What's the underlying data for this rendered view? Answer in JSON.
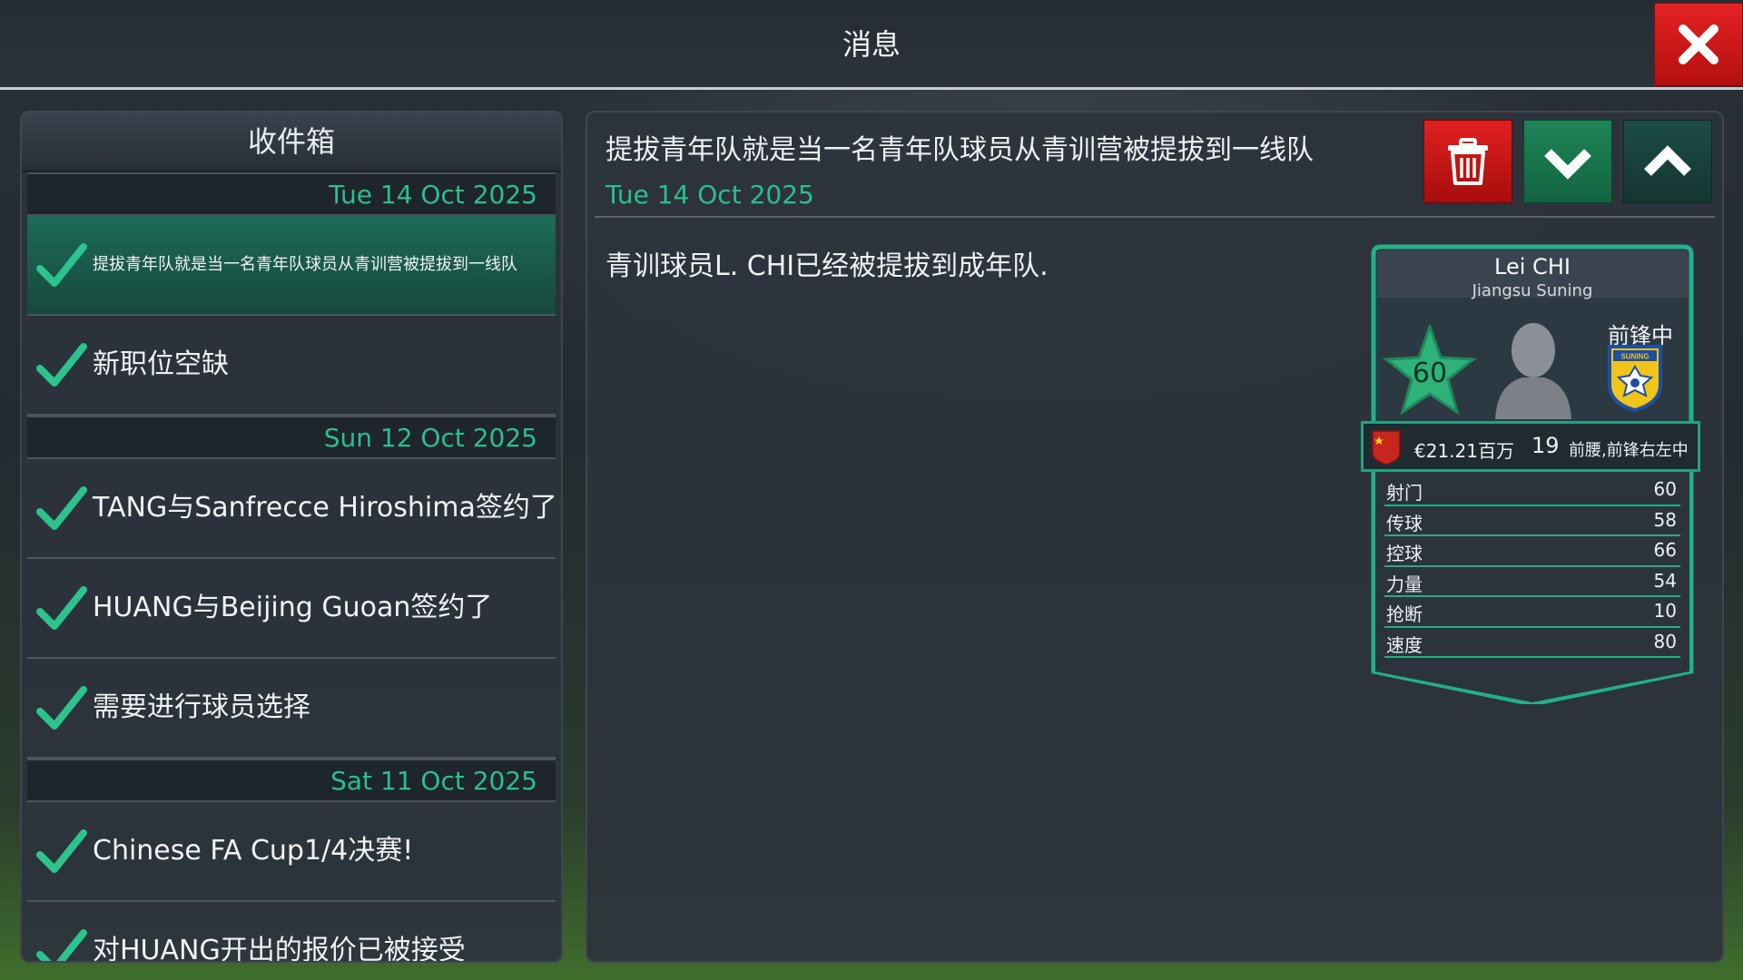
{
  "header": {
    "title": "消息",
    "close_icon": "close-icon"
  },
  "inbox": {
    "title": "收件箱",
    "groups": [
      {
        "date": "Tue 14 Oct 2025",
        "items": [
          {
            "label": "提拔青年队就是当一名青年队球员从青训营被提拔到一线队",
            "selected": true,
            "read_icon": "check-icon"
          },
          {
            "label": "新职位空缺",
            "selected": false,
            "read_icon": "check-icon"
          }
        ]
      },
      {
        "date": "Sun 12 Oct 2025",
        "items": [
          {
            "label": "TANG与Sanfrecce Hiroshima签约了",
            "selected": false,
            "read_icon": "check-icon"
          },
          {
            "label": "HUANG与Beijing Guoan签约了",
            "selected": false,
            "read_icon": "check-icon"
          },
          {
            "label": "需要进行球员选择",
            "selected": false,
            "read_icon": "check-icon"
          }
        ]
      },
      {
        "date": "Sat 11 Oct 2025",
        "items": [
          {
            "label": "Chinese FA Cup1/4决赛!",
            "selected": false,
            "read_icon": "check-icon"
          },
          {
            "label": "对HUANG开出的报价已被接受",
            "selected": false,
            "read_icon": "check-icon"
          }
        ]
      }
    ]
  },
  "message": {
    "subject": "提拔青年队就是当一名青年队球员从青训营被提拔到一线队",
    "date": "Tue 14 Oct 2025",
    "body": "青训球员L. CHI已经被提拔到成年队.",
    "actions": {
      "delete_icon": "trash-icon",
      "next_icon": "chevron-down-icon",
      "prev_icon": "chevron-up-icon"
    }
  },
  "player_card": {
    "name": "Lei CHI",
    "club": "Jiangsu Suning",
    "position": "前锋中",
    "rating": "60",
    "value": "€21.21百万",
    "age": "19",
    "roles": "前腰,前锋右左中",
    "badge_text": "SUNING",
    "stats": [
      {
        "name": "射门",
        "value": "60"
      },
      {
        "name": "传球",
        "value": "58"
      },
      {
        "name": "控球",
        "value": "66"
      },
      {
        "name": "力量",
        "value": "54"
      },
      {
        "name": "抢断",
        "value": "10"
      },
      {
        "name": "速度",
        "value": "80"
      }
    ]
  },
  "colors": {
    "accent_green": "#2bbf8e",
    "delete_red": "#d11b1b",
    "card_border": "#1fa47e"
  }
}
